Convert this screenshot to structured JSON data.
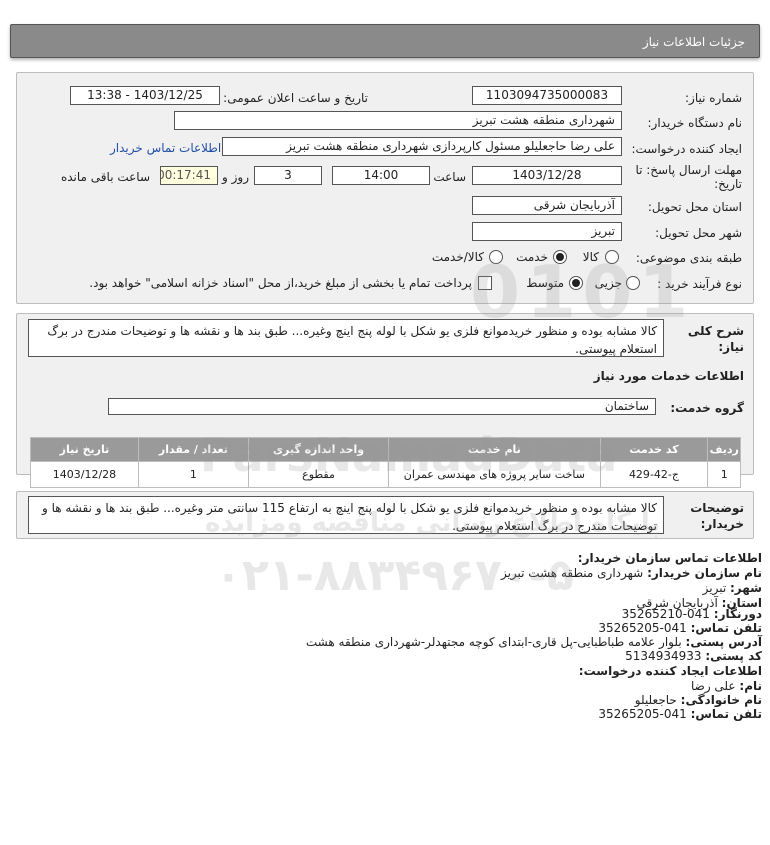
{
  "header": {
    "title": "جزئیات اطلاعات نیاز"
  },
  "form": {
    "need_number_label": "شماره نیاز:",
    "need_number": "1103094735000083",
    "announce_label": "تاریخ و ساعت اعلان عمومی:",
    "announce_value": "1403/12/25 - 13:38",
    "buyer_org_label": "نام دستگاه خریدار:",
    "buyer_org": "شهرداری منطقه هشت تبریز",
    "requester_label": "ایجاد کننده درخواست:",
    "requester": "علی رضا حاجعلیلو مسئول کارپردازی شهرداری منطقه هشت تبریز",
    "contact_link": "اطلاعات تماس خریدار",
    "deadline_label_1": "مهلت ارسال پاسخ: تا",
    "deadline_label_2": "تاریخ:",
    "deadline_date": "1403/12/28",
    "time_label": "ساعت",
    "deadline_time": "14:00",
    "days_value": "3",
    "days_label": "روز و",
    "remaining_time": "00:17:41",
    "remaining_label": "ساعت باقی مانده",
    "province_label": "استان محل تحویل:",
    "province": "آذربایجان شرقی",
    "city_label": "شهر محل تحویل:",
    "city": "تبریز",
    "category_label": "طبقه بندی موضوعی:",
    "category_options": [
      "کالا",
      "خدمت",
      "کالا/خدمت"
    ],
    "category_selected": "خدمت",
    "process_label": "نوع فرآیند خرید :",
    "process_options": [
      "جزیی",
      "متوسط"
    ],
    "process_selected": "متوسط",
    "treasury_text": "پرداخت تمام یا بخشی از مبلغ خرید،از محل \"اسناد خزانه اسلامی\" خواهد بود."
  },
  "description": {
    "label": "شرح کلی نیاز:",
    "text": "کالا مشابه بوده و منظور خریدموانع فلزی یو شکل با لوله پنج اینچ وغیره... طبق بند ها و نقشه ها و توضیحات مندرج در برگ استعلام پیوستی."
  },
  "services": {
    "title": "اطلاعات خدمات مورد نیاز",
    "group_label": "گروه خدمت:",
    "group_value": "ساختمان",
    "columns": [
      "ردیف",
      "کد خدمت",
      "نام خدمت",
      "واحد اندازه گیری",
      "تعداد / مقدار",
      "تاریخ نیاز"
    ],
    "rows": [
      [
        "1",
        "ج-42-429",
        "ساخت سایر پروژه های مهندسی عمران",
        "مقطوع",
        "1",
        "1403/12/28"
      ]
    ]
  },
  "buyer_notes": {
    "label": "توضیحات خریدار:",
    "text": "کالا مشابه بوده و منظور خریدموانع فلزی یو شکل با لوله پنج اینچ به ارتفاع 115 سانتی متر وغیره... طبق بند ها و نقشه ها و توضیحات مندرج در برگ استعلام پیوستی."
  },
  "contact": {
    "title": "اطلاعات تماس سازمان خریدار:",
    "org_label": "نام سازمان خریدار:",
    "org": "شهرداری منطقه هشت تبریز",
    "city_label": "شهر:",
    "city": "تبریز",
    "province_label": "استان:",
    "province": "آذربایجان شرقی",
    "fax_label": "دورنگار:",
    "fax": "041-35265210",
    "phone_label": "تلفن تماس:",
    "phone": "041-35265205",
    "address_label": "آدرس پستی:",
    "address": "بلوار علامه طباطبایی-پل قاری-ابتدای کوچه مجتهدلر-شهرداری منطقه هشت",
    "postal_label": "کد پستی:",
    "postal": "5134934933",
    "creator_title": "اطلاعات ایجاد کننده درخواست:",
    "first_name_label": "نام:",
    "first_name": "علی رضا",
    "last_name_label": "نام خانوادگی:",
    "last_name": "حاجعلیلو",
    "creator_phone_label": "تلفن تماس:",
    "creator_phone": "041-35265205"
  },
  "watermark": {
    "name": "ParsNamadData",
    "tagline": "پایگاه اطلاع رسانی مناقصه ومزایده",
    "phone": "۰۲۱-۸۸۳۴۹۶۷۰-۵",
    "number": "0101"
  }
}
